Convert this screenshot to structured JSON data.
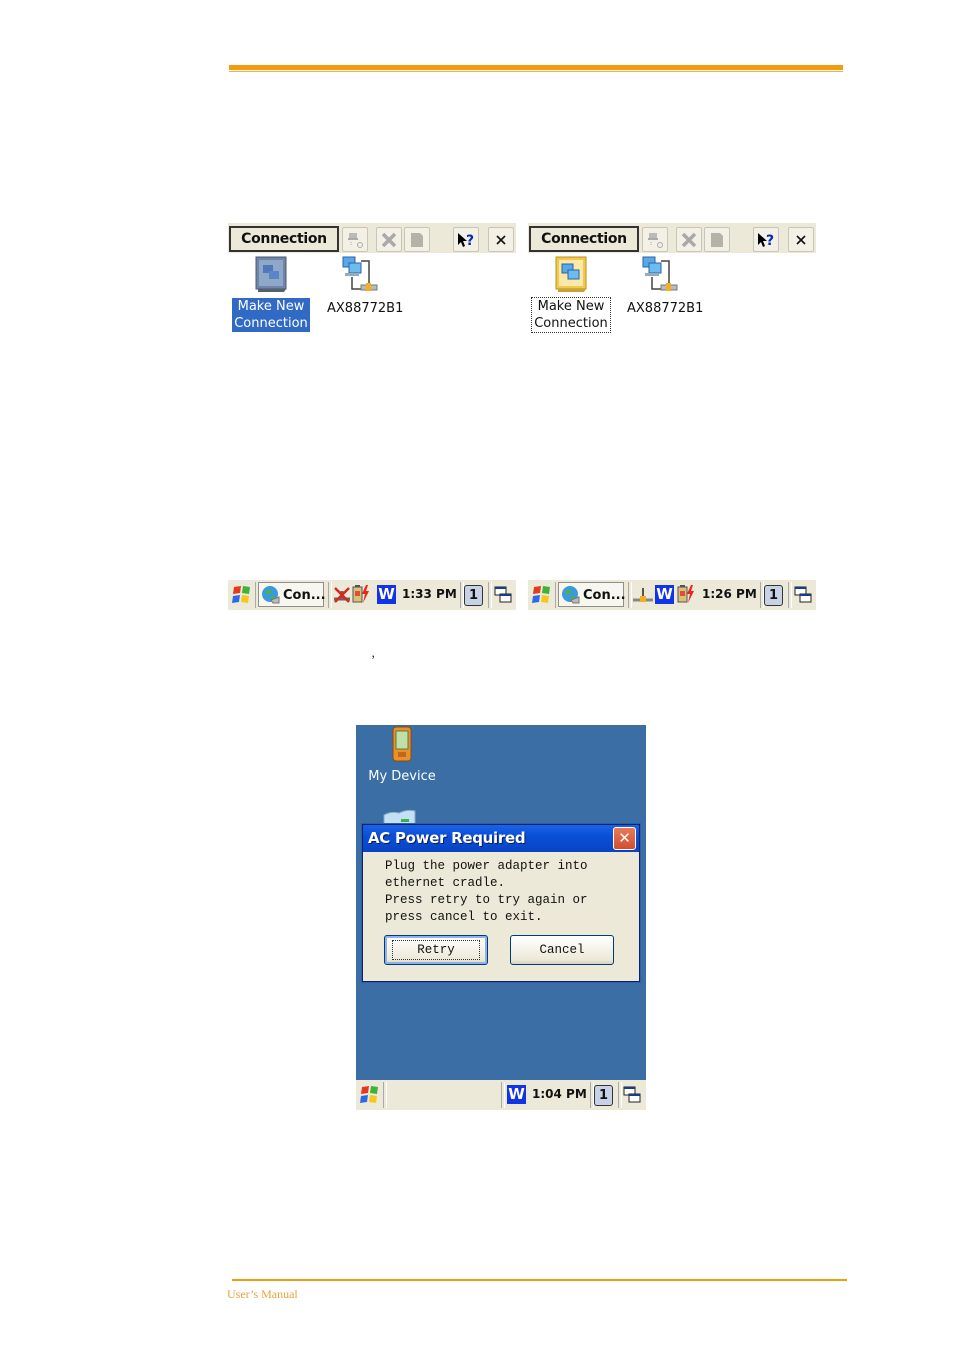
{
  "page": {
    "header_rule_color": "#f39c12",
    "footer_text": "User’s Manual",
    "stray_mark": "’"
  },
  "connection_windows": [
    {
      "menu_label": "Connection",
      "toolbar_icons": [
        "dial-up-properties-icon",
        "delete-icon",
        "blank-icon",
        "help-icon",
        "close-icon"
      ],
      "items": [
        {
          "label_line1": "Make New",
          "label_line2": "Connection",
          "icon": "make-new-connection-icon",
          "state": "selected"
        },
        {
          "label_line1": "AX88772B1",
          "label_line2": "",
          "icon": "network-connection-icon",
          "state": "normal"
        }
      ]
    },
    {
      "menu_label": "Connection",
      "toolbar_icons": [
        "dial-up-properties-icon",
        "delete-icon",
        "blank-icon",
        "help-icon",
        "close-icon"
      ],
      "items": [
        {
          "label_line1": "Make New",
          "label_line2": "Connection",
          "icon": "make-new-connection-icon",
          "state": "focused"
        },
        {
          "label_line1": "AX88772B1",
          "label_line2": "",
          "icon": "network-connection-icon",
          "state": "normal"
        }
      ]
    }
  ],
  "taskbars": [
    {
      "task_label": "Con...",
      "tray_icons": [
        "network-disconnected-icon",
        "battery-charging-icon",
        "wifi-w-icon"
      ],
      "time": "1:33 PM",
      "desktop_num": "1"
    },
    {
      "task_label": "Con...",
      "tray_icons": [
        "network-connected-icon",
        "wifi-w-icon",
        "battery-charging-icon"
      ],
      "time": "1:26 PM",
      "desktop_num": "1"
    }
  ],
  "device": {
    "desktop_icons": [
      {
        "label": "My Device",
        "icon": "my-device-icon"
      },
      {
        "label": "",
        "icon": "recycle-bin-icon"
      }
    ],
    "dialog": {
      "title": "AC Power Required",
      "close_glyph": "✕",
      "message": "Plug the power adapter into\nethernet cradle.\nPress retry to try again or\npress cancel to exit.",
      "buttons": {
        "retry": "Retry",
        "cancel": "Cancel"
      }
    },
    "taskbar": {
      "time": "1:04 PM",
      "desktop_num": "1",
      "tray_icons": [
        "wifi-w-icon"
      ]
    }
  }
}
